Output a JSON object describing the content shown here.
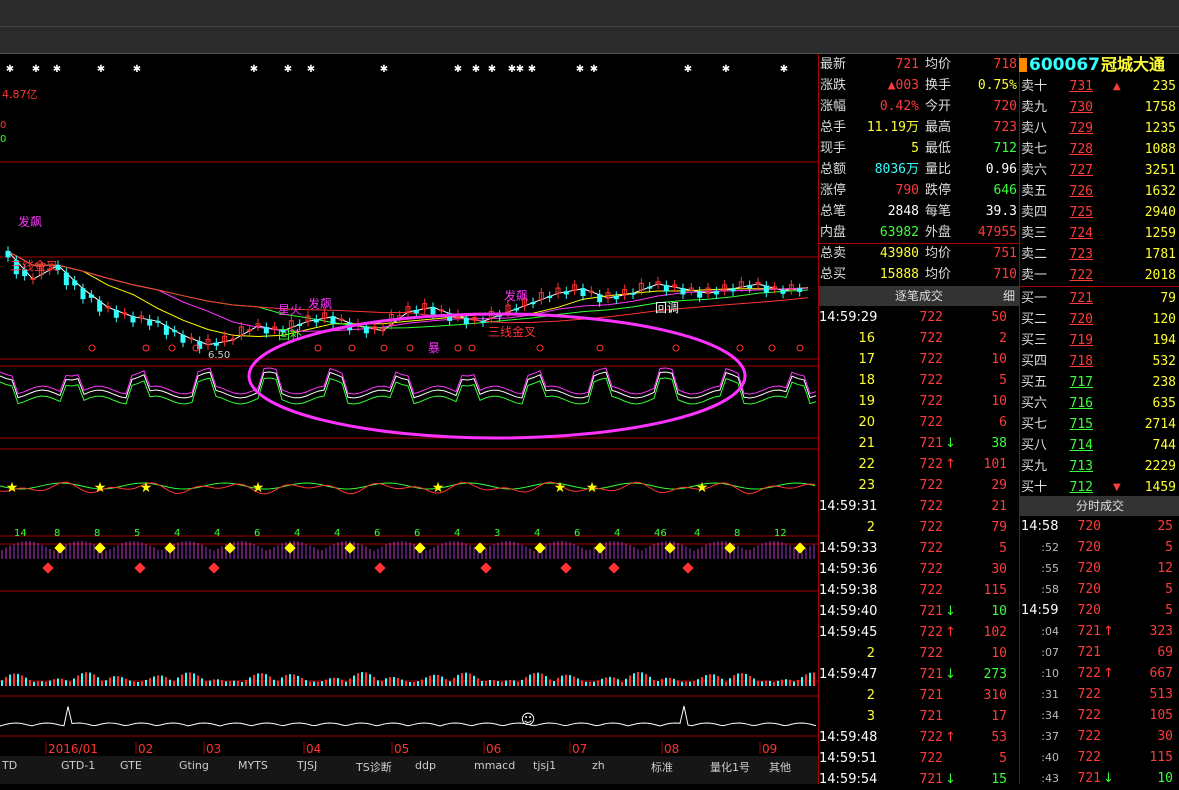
{
  "chart": {
    "amount_label": "4.87亿",
    "left_axis": [
      "0",
      "0"
    ],
    "price_low_marker": "6.50",
    "date_labels": [
      "2016/01",
      "02",
      "03",
      "04",
      "05",
      "06",
      "07",
      "08",
      "09"
    ],
    "annotations": [
      {
        "text": "发飙",
        "color": "#ff33ff"
      },
      {
        "text": "星火",
        "color": "#ff33ff"
      },
      {
        "text": "发飙",
        "color": "#ff33ff"
      },
      {
        "text": "回补",
        "color": "#33ff33"
      },
      {
        "text": "发飙",
        "color": "#ff33ff"
      },
      {
        "text": "回调",
        "color": "#ffffff"
      },
      {
        "text": "三线金叉",
        "color": "#ff3333"
      },
      {
        "text": "三线金叉",
        "color": "#ff3333"
      },
      {
        "text": "暴",
        "color": "#ff33ff"
      }
    ],
    "count_labels_row": [
      "14",
      "8",
      "8",
      "5",
      "4",
      "4",
      "6",
      "4",
      "4",
      "6",
      "6",
      "4",
      "3",
      "4",
      "6",
      "4",
      "46",
      "4",
      "8",
      "12"
    ]
  },
  "chart_data": {
    "type": "line",
    "title": "",
    "series": [
      {
        "name": "",
        "values": [
          7.6,
          7.3,
          7.45,
          7.2,
          7.0,
          6.9,
          6.85,
          6.7,
          6.6,
          6.65,
          6.8,
          6.75,
          6.85,
          6.9,
          6.8,
          6.75,
          6.95,
          7.0,
          6.9,
          6.85,
          6.95,
          7.05,
          7.15,
          7.2,
          7.1,
          7.15,
          7.25,
          7.2,
          7.15,
          7.2,
          7.25,
          7.18,
          7.21
        ]
      }
    ],
    "ylim": [
      6.5,
      8.0
    ]
  },
  "tabs": [
    "TD",
    "GTD-1",
    "GTE",
    "Gting",
    "MYTS",
    "TJSJ",
    "TS诊断",
    "ddp",
    "mmacd",
    "tjsj1",
    "zh",
    "标准",
    "量化1号",
    "其他"
  ],
  "quote": {
    "code": "600067",
    "name": "冠城大通",
    "stats": [
      {
        "l1": "最新",
        "v1": "721",
        "c1": "red",
        "l2": "均价",
        "v2": "718",
        "c2": "red"
      },
      {
        "l1": "涨跌",
        "v1": "▲003",
        "c1": "red",
        "l2": "换手",
        "v2": "0.75%",
        "c2": "yel"
      },
      {
        "l1": "涨幅",
        "v1": "0.42%",
        "c1": "red",
        "l2": "今开",
        "v2": "720",
        "c2": "red"
      },
      {
        "l1": "总手",
        "v1": "11.19万",
        "c1": "yel",
        "l2": "最高",
        "v2": "723",
        "c2": "red"
      },
      {
        "l1": "现手",
        "v1": "5",
        "c1": "yel",
        "l2": "最低",
        "v2": "712",
        "c2": "grn"
      },
      {
        "l1": "总额",
        "v1": "8036万",
        "c1": "cyn",
        "l2": "量比",
        "v2": "0.96",
        "c2": "wht"
      },
      {
        "l1": "涨停",
        "v1": "790",
        "c1": "red",
        "l2": "跌停",
        "v2": "646",
        "c2": "grn"
      },
      {
        "l1": "总笔",
        "v1": "2848",
        "c1": "wht",
        "l2": "每笔",
        "v2": "39.3",
        "c2": "wht"
      },
      {
        "l1": "内盘",
        "v1": "63982",
        "c1": "grn",
        "l2": "外盘",
        "v2": "47955",
        "c2": "red"
      },
      {
        "l1": "总卖",
        "v1": "43980",
        "c1": "yel",
        "l2": "均价",
        "v2": "751",
        "c2": "red"
      },
      {
        "l1": "总买",
        "v1": "15888",
        "c1": "yel",
        "l2": "均价",
        "v2": "710",
        "c2": "red"
      }
    ],
    "sells": [
      {
        "l": "卖十",
        "p": "731",
        "v": "235"
      },
      {
        "l": "卖九",
        "p": "730",
        "v": "1758"
      },
      {
        "l": "卖八",
        "p": "729",
        "v": "1235"
      },
      {
        "l": "卖七",
        "p": "728",
        "v": "1088"
      },
      {
        "l": "卖六",
        "p": "727",
        "v": "3251"
      },
      {
        "l": "卖五",
        "p": "726",
        "v": "1632"
      },
      {
        "l": "卖四",
        "p": "725",
        "v": "2940"
      },
      {
        "l": "卖三",
        "p": "724",
        "v": "1259"
      },
      {
        "l": "卖二",
        "p": "723",
        "v": "1781"
      },
      {
        "l": "卖一",
        "p": "722",
        "v": "2018"
      }
    ],
    "buys": [
      {
        "l": "买一",
        "p": "721",
        "v": "79",
        "c": "red"
      },
      {
        "l": "买二",
        "p": "720",
        "v": "120",
        "c": "red"
      },
      {
        "l": "买三",
        "p": "719",
        "v": "194",
        "c": "red"
      },
      {
        "l": "买四",
        "p": "718",
        "v": "532",
        "c": "red"
      },
      {
        "l": "买五",
        "p": "717",
        "v": "238",
        "c": "grn"
      },
      {
        "l": "买六",
        "p": "716",
        "v": "635",
        "c": "grn"
      },
      {
        "l": "买七",
        "p": "715",
        "v": "2714",
        "c": "grn"
      },
      {
        "l": "买八",
        "p": "714",
        "v": "744",
        "c": "grn"
      },
      {
        "l": "买九",
        "p": "713",
        "v": "2229",
        "c": "grn"
      },
      {
        "l": "买十",
        "p": "712",
        "v": "1459",
        "c": "grn"
      }
    ],
    "tick_header": "逐笔成交",
    "tick_header_btn": "细",
    "ticks": [
      {
        "t": "14:59:29",
        "p": "722",
        "v": "50",
        "a": ""
      },
      {
        "t": "16",
        "p": "722",
        "v": "2",
        "a": ""
      },
      {
        "t": "17",
        "p": "722",
        "v": "10",
        "a": ""
      },
      {
        "t": "18",
        "p": "722",
        "v": "5",
        "a": ""
      },
      {
        "t": "19",
        "p": "722",
        "v": "10",
        "a": ""
      },
      {
        "t": "20",
        "p": "722",
        "v": "6",
        "a": ""
      },
      {
        "t": "21",
        "p": "721",
        "v": "38",
        "a": "dn"
      },
      {
        "t": "22",
        "p": "722",
        "v": "101",
        "a": "up"
      },
      {
        "t": "23",
        "p": "722",
        "v": "29",
        "a": ""
      },
      {
        "t": "14:59:31",
        "p": "722",
        "v": "21",
        "a": ""
      },
      {
        "t": "2",
        "p": "722",
        "v": "79",
        "a": ""
      },
      {
        "t": "14:59:33",
        "p": "722",
        "v": "5",
        "a": ""
      },
      {
        "t": "14:59:36",
        "p": "722",
        "v": "30",
        "a": ""
      },
      {
        "t": "14:59:38",
        "p": "722",
        "v": "115",
        "a": ""
      },
      {
        "t": "14:59:40",
        "p": "721",
        "v": "10",
        "a": "dn"
      },
      {
        "t": "14:59:45",
        "p": "722",
        "v": "102",
        "a": "up"
      },
      {
        "t": "2",
        "p": "722",
        "v": "10",
        "a": ""
      },
      {
        "t": "14:59:47",
        "p": "721",
        "v": "273",
        "a": "dn"
      },
      {
        "t": "2",
        "p": "721",
        "v": "310",
        "a": ""
      },
      {
        "t": "3",
        "p": "721",
        "v": "17",
        "a": ""
      },
      {
        "t": "14:59:48",
        "p": "722",
        "v": "53",
        "a": "up"
      },
      {
        "t": "14:59:51",
        "p": "722",
        "v": "5",
        "a": ""
      },
      {
        "t": "14:59:54",
        "p": "721",
        "v": "15",
        "a": "dn"
      }
    ],
    "minute_header": "分时成交",
    "minutes": [
      {
        "t": "14:58",
        "p": "720",
        "v": "25",
        "a": "",
        "big": true
      },
      {
        "t": ":52",
        "p": "720",
        "v": "5",
        "a": ""
      },
      {
        "t": ":55",
        "p": "720",
        "v": "12",
        "a": ""
      },
      {
        "t": ":58",
        "p": "720",
        "v": "5",
        "a": ""
      },
      {
        "t": "14:59",
        "p": "720",
        "v": "5",
        "a": "",
        "big": true
      },
      {
        "t": ":04",
        "p": "721",
        "v": "323",
        "a": "up"
      },
      {
        "t": ":07",
        "p": "721",
        "v": "69",
        "a": ""
      },
      {
        "t": ":10",
        "p": "722",
        "v": "667",
        "a": "up"
      },
      {
        "t": ":31",
        "p": "722",
        "v": "513",
        "a": ""
      },
      {
        "t": ":34",
        "p": "722",
        "v": "105",
        "a": ""
      },
      {
        "t": ":37",
        "p": "722",
        "v": "30",
        "a": ""
      },
      {
        "t": ":40",
        "p": "722",
        "v": "115",
        "a": ""
      },
      {
        "t": ":43",
        "p": "721",
        "v": "10",
        "a": "dn"
      }
    ]
  }
}
